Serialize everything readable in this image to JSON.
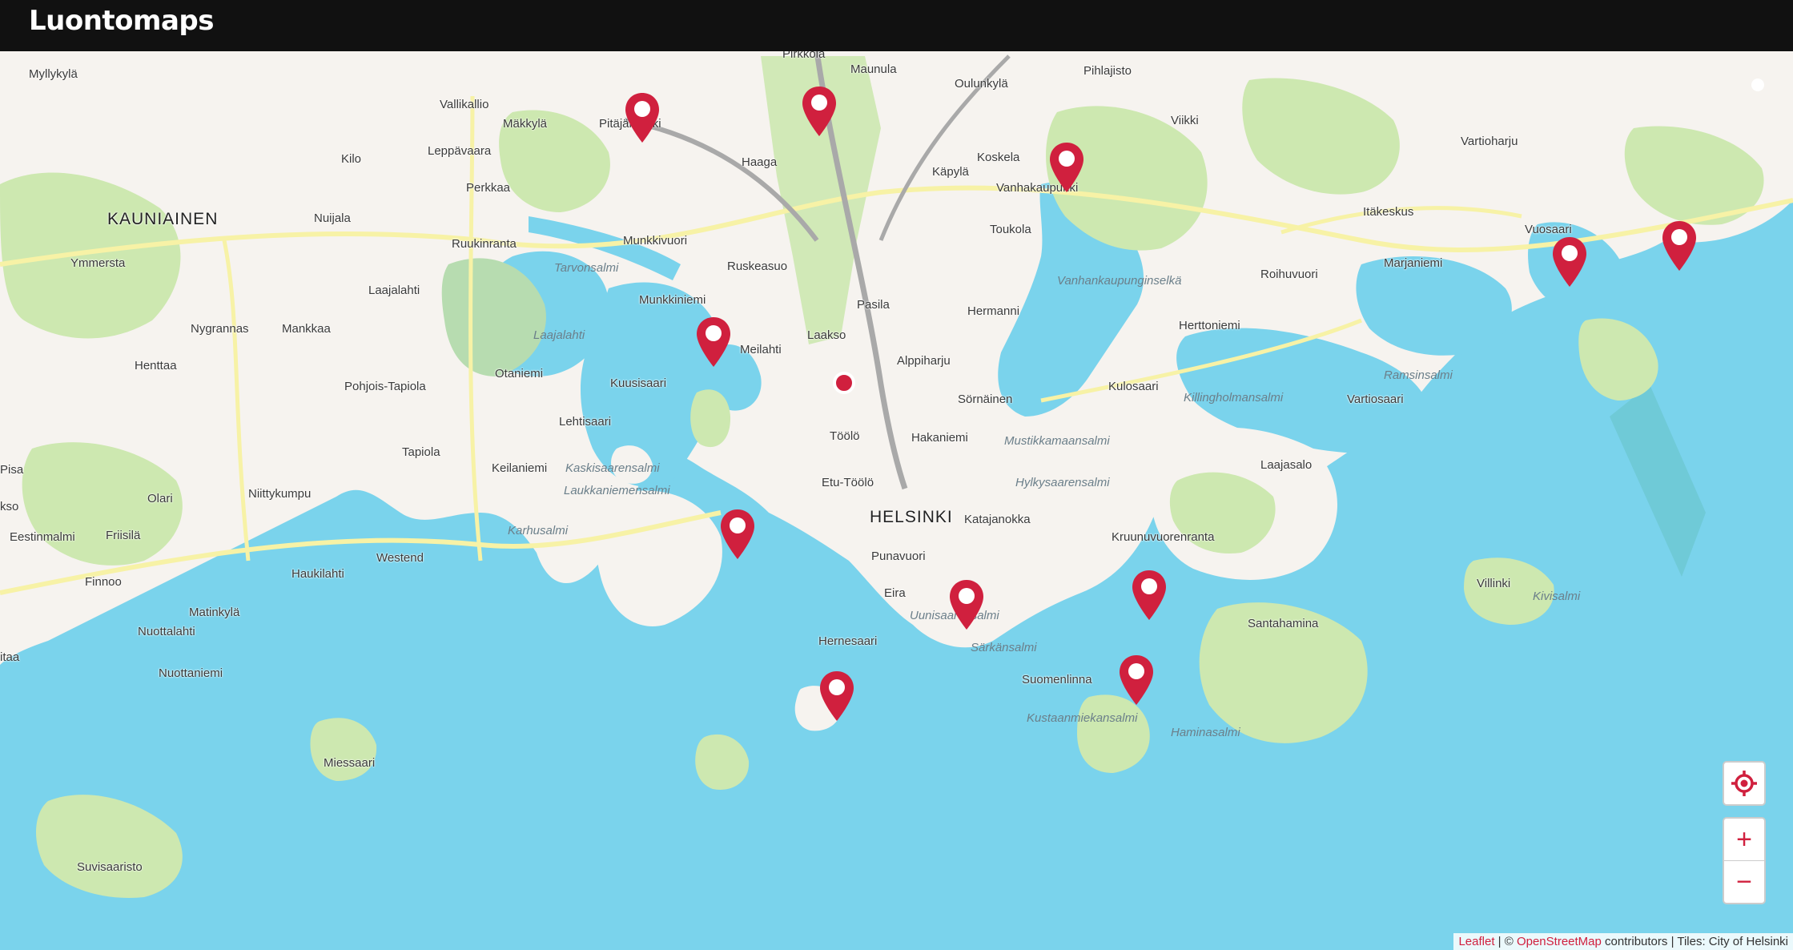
{
  "app": {
    "title": "Luontomaps"
  },
  "colors": {
    "water": "#7ad3ec",
    "land": "#f6f3ef",
    "park": "#cde8b0",
    "road": "#f7f2a6",
    "accent": "#d0203e"
  },
  "controls": {
    "locate_icon": "crosshair-icon",
    "zoom_in": "+",
    "zoom_out": "−"
  },
  "attribution": {
    "leaflet": "Leaflet",
    "sep1": " | © ",
    "osm": "OpenStreetMap",
    "rest": " contributors | Tiles: City of Helsinki"
  },
  "labels": {
    "myllykyla": "Myllykylä",
    "vallikallio": "Vallikallio",
    "makkyla": "Mäkkylä",
    "pitajanmaki": "Pitäjänmäki",
    "pirkkola": "Pirkkola",
    "maunula": "Maunula",
    "oulunkyla": "Oulunkylä",
    "pihlajisto": "Pihlajisto",
    "viikki": "Viikki",
    "vartioharju": "Vartioharju",
    "leppavaara": "Leppävaara",
    "kilo": "Kilo",
    "haaga": "Haaga",
    "koskela": "Koskela",
    "kapyla": "Käpylä",
    "vanhakaupunki": "Vanhakaupunki",
    "kauniainen": "KAUNIAINEN",
    "perkkaa": "Perkkaa",
    "nuijala": "Nuijala",
    "ruukinranta": "Ruukinranta",
    "munkkivuori": "Munkkivuori",
    "toukola": "Toukola",
    "itakeskus": "Itäkeskus",
    "vuosaari": "Vuosaari",
    "ymmersta": "Ymmersta",
    "tarvonsalmi": "Tarvonsalmi",
    "ruskeasuo": "Ruskeasuo",
    "roihuvuori": "Roihuvuori",
    "marjaniemi": "Marjaniemi",
    "laajalahti_district": "Laajalahti",
    "munkkiniemi": "Munkkiniemi",
    "vanhankaupunginselka": "Vanhankaupunginselkä",
    "pasila": "Pasila",
    "hermanni": "Hermanni",
    "nygrannas": "Nygrannas",
    "mankkaa": "Mankkaa",
    "laajalahti_bay": "Laajalahti",
    "laakso": "Laakso",
    "herttoniemi": "Herttoniemi",
    "henttaa": "Henttaa",
    "otaniemi": "Otaniemi",
    "meilahti": "Meilahti",
    "alppiharju": "Alppiharju",
    "ramsinsalmi": "Ramsinsalmi",
    "pohjois_tapiola": "Pohjois-Tapiola",
    "kuusisaari": "Kuusisaari",
    "kulosaari": "Kulosaari",
    "killingholmansalmi": "Killingholmansalmi",
    "sornainen": "Sörnäinen",
    "vartiosaari": "Vartiosaari",
    "lehtisaari": "Lehtisaari",
    "toolo": "Töölö",
    "hakaniemi": "Hakaniemi",
    "mustikkamaansalmi": "Mustikkamaansalmi",
    "tapiola": "Tapiola",
    "pisa": "Pisa",
    "keilaniemi": "Keilaniemi",
    "kaskisaarensalmi": "Kaskisaarensalmi",
    "laajasalo": "Laajasalo",
    "olari": "Olari",
    "niittykumpu": "Niittykumpu",
    "etu_toolo": "Etu-Töölö",
    "hylkysaarensalmi": "Hylkysaarensalmi",
    "laukkaniemensalmi": "Laukkaniemensalmi",
    "kso": "kso",
    "helsinki": "HELSINKI",
    "katajanokka": "Katajanokka",
    "eestinmalmi": "Eestinmalmi",
    "friisila": "Friisilä",
    "karhusalmi": "Karhusalmi",
    "kruunuvuorenranta": "Kruunuvuorenranta",
    "westend": "Westend",
    "punavuori": "Punavuori",
    "haukilahti": "Haukilahti",
    "finnoo": "Finnoo",
    "villinki": "Villinki",
    "kivisalmi": "Kivisalmi",
    "eira": "Eira",
    "matinkyla": "Matinkylä",
    "uunisaarensalmi": "Uunisaarensalmi",
    "santahamina": "Santahamina",
    "nuottalahti": "Nuottalahti",
    "hernesaari": "Hernesaari",
    "sarkansalmi": "Särkänsalmi",
    "itaa": "itaa",
    "nuottaniemi": "Nuottaniemi",
    "suomenlinna": "Suomenlinna",
    "kustaanmiekansalmi": "Kustaanmiekansalmi",
    "haminasalmi": "Haminasalmi",
    "miessaari": "Miessaari",
    "suvisaaristo": "Suvisaaristo"
  }
}
